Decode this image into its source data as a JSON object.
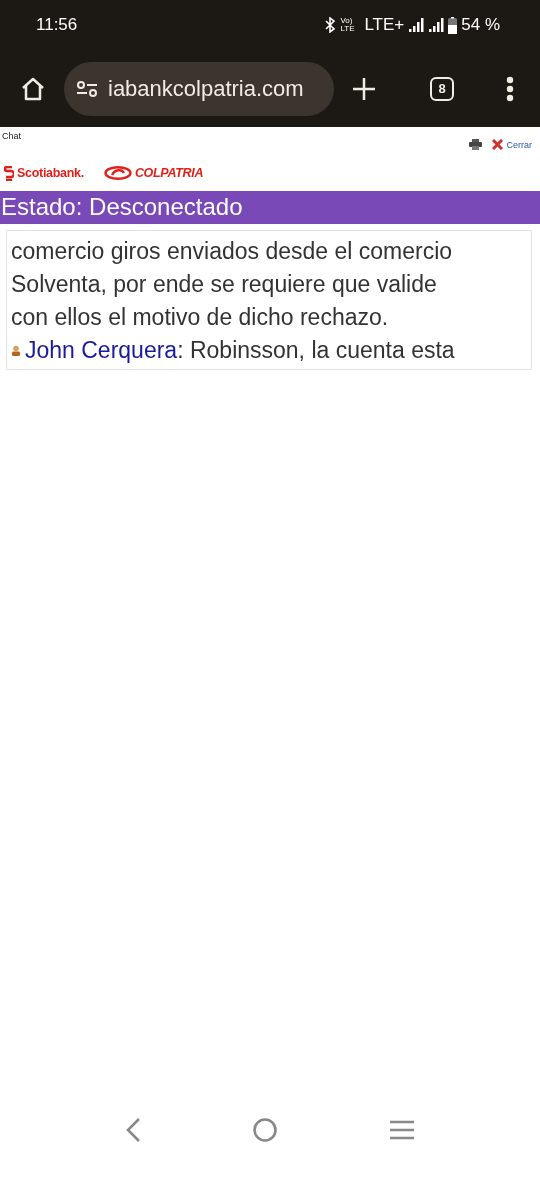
{
  "status_bar": {
    "time": "11:56",
    "network_label": "LTE+",
    "volte_label": "Vo) LTE",
    "battery": "54 %"
  },
  "browser": {
    "url": "iabankcolpatria.com",
    "tab_count": "8"
  },
  "page": {
    "title": "Chat",
    "close_label": "Cerrar",
    "brands": [
      "Scotiabank.",
      "COLPATRIA"
    ],
    "status": "Estado: Desconectado",
    "messages": [
      {
        "kind": "text",
        "lines": [
          "comercio giros enviados desde el comercio",
          "Solventa, por ende se requiere que valide",
          "con ellos el motivo de dicho rechazo."
        ]
      },
      {
        "kind": "author",
        "author": "John Cerquera",
        "lines": [
          ": Robinsson, la cuenta esta"
        ]
      }
    ]
  }
}
